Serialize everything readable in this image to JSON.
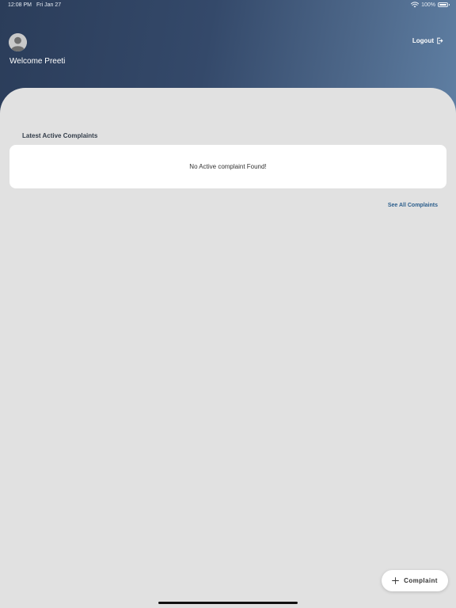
{
  "status_bar": {
    "time": "12:08 PM",
    "date": "Fri Jan 27",
    "battery": "100%"
  },
  "header": {
    "welcome_text": "Welcome Preeti",
    "logout_label": "Logout",
    "gradient_colors": [
      "#2b3d5a",
      "#5f7fa3"
    ]
  },
  "complaints": {
    "section_title": "Latest Active Complaints",
    "empty_message": "No Active complaint Found!",
    "see_all_label": "See All Complaints"
  },
  "fab": {
    "label": "Complaint",
    "icon": "plus-icon"
  },
  "colors": {
    "background": "#e1e1e1",
    "card": "#ffffff",
    "link": "#2c5e8c"
  }
}
